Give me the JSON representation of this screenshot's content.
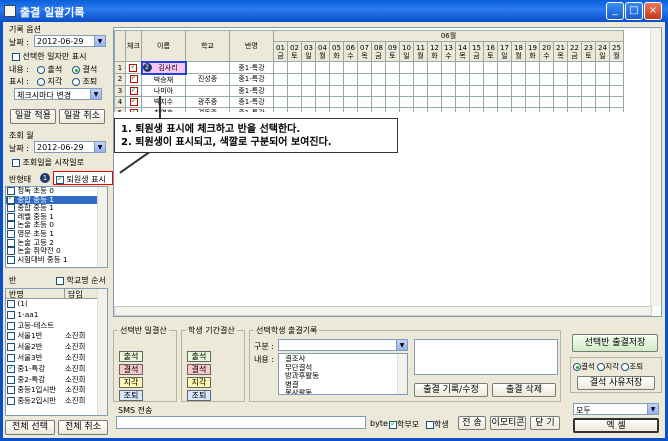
{
  "window": {
    "title": "출결 일괄기록",
    "minimize": "_",
    "maximize": "□",
    "close": "×"
  },
  "left": {
    "record_option": {
      "title": "기록 옵션",
      "date_label": "날짜 :",
      "date_value": "2012-06-29",
      "only_selected_date": "선택한 일자만 표시",
      "content_label": "내용 :",
      "content_opt1": "출석",
      "content_opt2": "결석",
      "display_label": "표시 :",
      "display_opt1": "지각",
      "display_opt2": "조퇴",
      "change_select": "체크시마다 변경"
    },
    "apply_button": "일괄 적용",
    "cancel_button": "일괄 취소",
    "query": {
      "title": "조회 월",
      "date_label": "날짜 :",
      "date_value": "2012-06-29",
      "start_day_label": "조회일을 시작일로"
    },
    "class_status": {
      "label": "반형태",
      "badge": "1",
      "withdrawn_label": "퇴원생 표시",
      "items": [
        "정독 초등 0",
        "중합 중등 1",
        "종합 중등 1",
        "레벨 중등 1",
        "논술 초등 0",
        "영문 초등 1",
        "논술 고등 2",
        "논술 취약전 0",
        "시험대비 중등 1"
      ]
    },
    "class": {
      "label": "반",
      "school_name_order": "학교명 순서",
      "col_class": "반명",
      "col_teacher": "담임",
      "rows": [
        [
          "(1(",
          ""
        ],
        [
          "1-aa1",
          ""
        ],
        [
          "고등-테스트",
          ""
        ],
        [
          "서울1반",
          "소진희"
        ],
        [
          "서울2반",
          "소진희"
        ],
        [
          "서울3반",
          "소진희"
        ],
        [
          "중1-특강",
          "소진희"
        ],
        [
          "중2-특강",
          "소진희"
        ],
        [
          "중등1입시반",
          "소진희"
        ],
        [
          "중등2입시반",
          "소진희"
        ]
      ]
    },
    "select_all": "전체 선택",
    "deselect_all": "전체 취소"
  },
  "grid": {
    "month": "06월",
    "col_check": "체크",
    "col_name": "이름",
    "col_school": "학교",
    "col_class": "반명",
    "days": [
      [
        "01",
        "금"
      ],
      [
        "02",
        "토"
      ],
      [
        "03",
        "일"
      ],
      [
        "04",
        "월"
      ],
      [
        "05",
        "화"
      ],
      [
        "06",
        "수"
      ],
      [
        "07",
        "목"
      ],
      [
        "08",
        "금"
      ],
      [
        "09",
        "토"
      ],
      [
        "10",
        "일"
      ],
      [
        "11",
        "월"
      ],
      [
        "12",
        "화"
      ],
      [
        "13",
        "수"
      ],
      [
        "14",
        "목"
      ],
      [
        "15",
        "금"
      ],
      [
        "16",
        "토"
      ],
      [
        "17",
        "일"
      ],
      [
        "18",
        "월"
      ],
      [
        "19",
        "화"
      ],
      [
        "20",
        "수"
      ],
      [
        "21",
        "목"
      ],
      [
        "22",
        "금"
      ],
      [
        "23",
        "토"
      ],
      [
        "24",
        "일"
      ],
      [
        "25",
        "월"
      ]
    ],
    "rows": [
      {
        "no": "1",
        "name": "김사리",
        "school": "",
        "class": "중1-특강",
        "badge": "2"
      },
      {
        "no": "2",
        "name": "박승재",
        "school": "진성중",
        "class": "중1-특강",
        "badge": ""
      },
      {
        "no": "3",
        "name": "나미아",
        "school": "",
        "class": "중1-특강",
        "badge": ""
      },
      {
        "no": "4",
        "name": "박지수",
        "school": "광주중",
        "class": "중1-특강",
        "badge": ""
      },
      {
        "no": "5",
        "name": "최영호",
        "school": "경동중",
        "class": "중1-특강",
        "badge": ""
      }
    ]
  },
  "callout": {
    "line1": "1. 퇴원생 표시에 체크하고 반을 선택한다.",
    "line2": "2. 퇴원생이 표시되고, 색깔로 구분되어 보여진다."
  },
  "bottom": {
    "class_summary": {
      "title": "선택반 일결산",
      "s1": "출석",
      "s2": "결석",
      "s3": "지각",
      "s4": "조퇴"
    },
    "student_summary": {
      "title": "학생 기간결산",
      "s1": "출석",
      "s2": "결석",
      "s3": "지각",
      "s4": "조퇴"
    },
    "attendance_record": {
      "title": "선택학생 출결기록",
      "category_label": "구분 :",
      "content_label": "내용 :",
      "items": [
        "결조사",
        "무단결석",
        "방과후활동",
        "병결",
        "봉사활동"
      ],
      "save_edit": "출결 기록/수정",
      "delete": "출결 삭제"
    },
    "save_class_attendance": "선택반 출결저장",
    "radio_opt1": "결석",
    "radio_opt2": "지각",
    "radio_opt3": "조퇴",
    "save_reason": "결석 사유저장",
    "sms_title": "SMS 전송",
    "byte_label": "byte",
    "parent_label": "학부모",
    "student_label": "학생",
    "send": "전 송",
    "emoticon": "이모티콘",
    "close": "닫 기",
    "target_select": "모두",
    "excel": "엑 셀"
  }
}
